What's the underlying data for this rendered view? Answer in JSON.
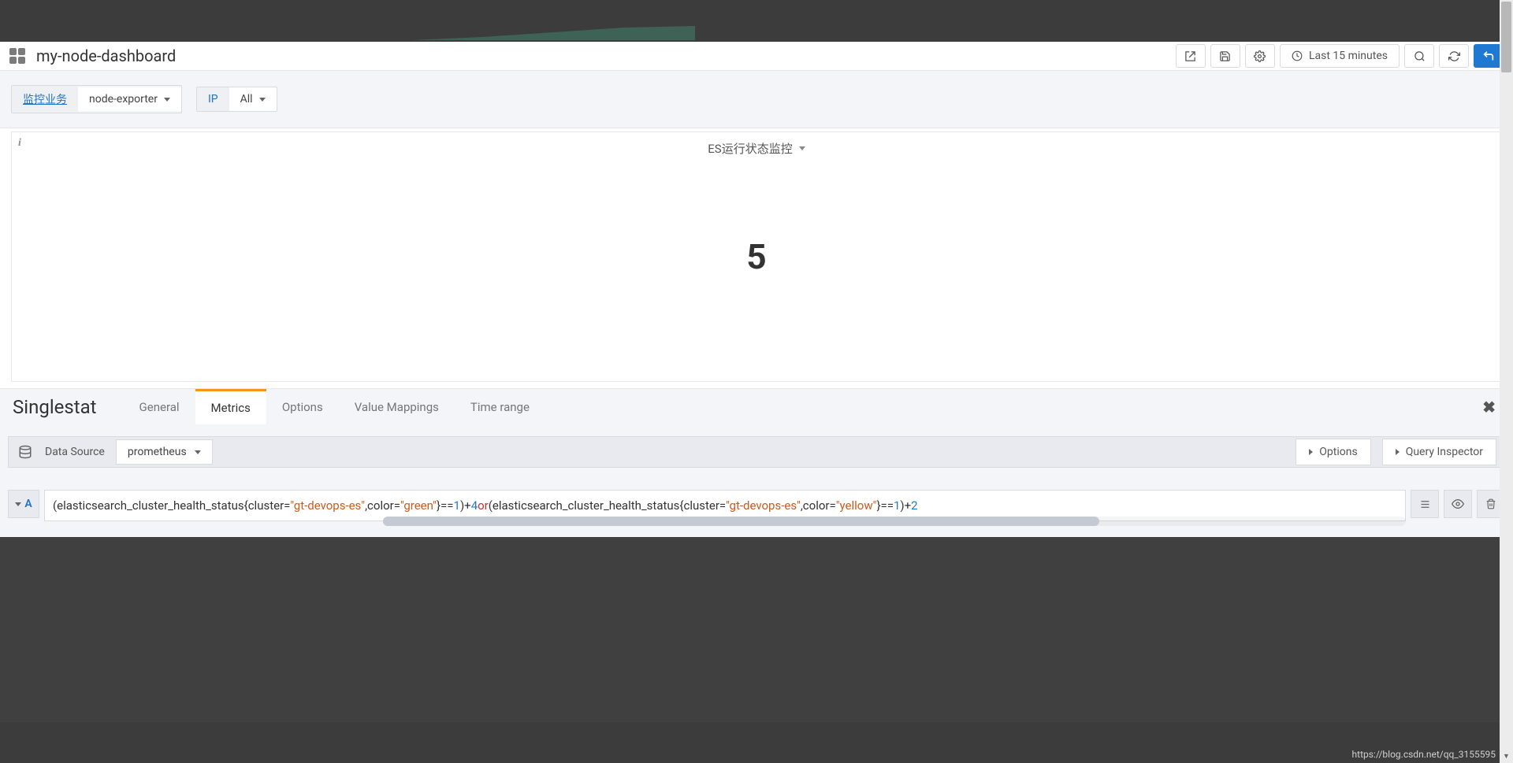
{
  "header": {
    "dashboard_title": "my-node-dashboard",
    "time_range": "Last 15 minutes"
  },
  "variables": {
    "label1": "监控业务",
    "value1": "node-exporter",
    "label2": "IP",
    "value2": "All"
  },
  "panel": {
    "title": "ES运行状态监控",
    "value": "5"
  },
  "editor": {
    "name": "Singlestat",
    "tabs": [
      "General",
      "Metrics",
      "Options",
      "Value Mappings",
      "Time range"
    ],
    "active_tab": "Metrics"
  },
  "datasource": {
    "label": "Data Source",
    "value": "prometheus",
    "options_label": "Options",
    "inspector_label": "Query Inspector"
  },
  "query": {
    "letter": "A",
    "prefix_trunc": "(elasticsearch_cluster_health_status{cluster=",
    "str1": "\"gt-devops-es\"",
    "mid1": ",color=",
    "str2": "\"green\"",
    "eq1": "}==",
    "num1": "1",
    "plus1": ")+",
    "num2": "4",
    "or": " or ",
    "prefix2": "(elasticsearch_cluster_health_status{cluster=",
    "str3": "\"gt-devops-es\"",
    "mid2": ",color=",
    "str4": "\"yellow\"",
    "eq2": "}==",
    "num3": "1",
    "plus2": ")+",
    "num4": "2"
  },
  "footer": {
    "url_partial": "https://blog.csdn.net/qq_3155595"
  }
}
